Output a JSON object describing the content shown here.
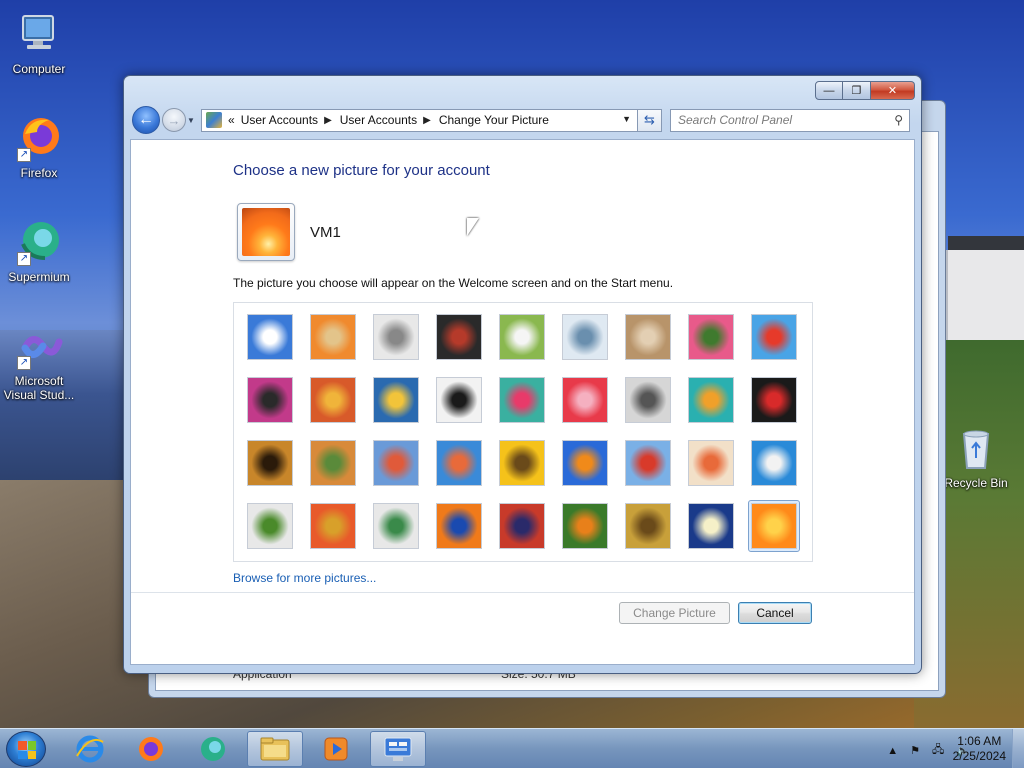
{
  "desktop": {
    "icons": [
      {
        "label": "Computer"
      },
      {
        "label": "Firefox"
      },
      {
        "label": "Supermium"
      },
      {
        "label": "Microsoft Visual Stud..."
      },
      {
        "label": "Recycle Bin"
      }
    ]
  },
  "background_window": {
    "bottom_left_text": "Application",
    "bottom_mid_text": "Size: 50.7 MB"
  },
  "window": {
    "controls": {
      "minimize": "—",
      "maximize": "❐",
      "close": "✕"
    },
    "breadcrumb": [
      "User Accounts",
      "User Accounts",
      "Change Your Picture"
    ],
    "breadcrumb_prefix": "«",
    "search": {
      "placeholder": "Search Control Panel"
    },
    "heading": "Choose a new picture for your account",
    "username": "VM1",
    "description": "The picture you choose will appear on the Welcome screen and on the Start menu.",
    "pictures": [
      {
        "name": "roller-coaster",
        "colors": [
          "#3a7ad8",
          "#ffffff"
        ]
      },
      {
        "name": "starfish",
        "colors": [
          "#f08a2e",
          "#e3c48a"
        ]
      },
      {
        "name": "robot-toy",
        "colors": [
          "#e8e8e8",
          "#888888"
        ]
      },
      {
        "name": "record-player",
        "colors": [
          "#2a2a2a",
          "#b53a2a"
        ]
      },
      {
        "name": "lucky-cat",
        "colors": [
          "#8ab84f",
          "#f5f5f5"
        ]
      },
      {
        "name": "spinning-top",
        "colors": [
          "#dfe9f2",
          "#6a8fae"
        ]
      },
      {
        "name": "kitten",
        "colors": [
          "#b8946a",
          "#e3cfb3"
        ]
      },
      {
        "name": "pink-flower",
        "colors": [
          "#e85a8a",
          "#3f7a2e"
        ]
      },
      {
        "name": "ferris-wheel",
        "colors": [
          "#49a4e6",
          "#e63a2a"
        ]
      },
      {
        "name": "ball",
        "colors": [
          "#c23a8a",
          "#2a2a2a"
        ]
      },
      {
        "name": "fabric",
        "colors": [
          "#d85a2a",
          "#f0b43a"
        ]
      },
      {
        "name": "leaf",
        "colors": [
          "#2a6ab0",
          "#f2c43a"
        ]
      },
      {
        "name": "dog",
        "colors": [
          "#f2f2f2",
          "#1a1a1a"
        ]
      },
      {
        "name": "crayons",
        "colors": [
          "#3ab0a0",
          "#e83a6a"
        ]
      },
      {
        "name": "paper-star",
        "colors": [
          "#e83a4a",
          "#f5b0c0"
        ]
      },
      {
        "name": "jacks",
        "colors": [
          "#d6d6d6",
          "#555555"
        ]
      },
      {
        "name": "stairs",
        "colors": [
          "#2ab0b0",
          "#f0a02a"
        ]
      },
      {
        "name": "paper-crane",
        "colors": [
          "#1a1a1a",
          "#d82a2a"
        ]
      },
      {
        "name": "guitar",
        "colors": [
          "#c8862a",
          "#2a1a0a"
        ]
      },
      {
        "name": "puppy",
        "colors": [
          "#d88a3a",
          "#5a8a3a"
        ]
      },
      {
        "name": "toy-robot",
        "colors": [
          "#6a9ad8",
          "#e05a3a"
        ]
      },
      {
        "name": "textile",
        "colors": [
          "#3a8ad8",
          "#e86a3a"
        ]
      },
      {
        "name": "sunflower",
        "colors": [
          "#f5c21a",
          "#6a4a1a"
        ]
      },
      {
        "name": "fish",
        "colors": [
          "#2a6ad8",
          "#f08a1a"
        ]
      },
      {
        "name": "hot-air-balloon",
        "colors": [
          "#7ab0e6",
          "#d83a2a"
        ]
      },
      {
        "name": "doll",
        "colors": [
          "#f2e0c8",
          "#e86a3a"
        ]
      },
      {
        "name": "sailboat",
        "colors": [
          "#2a8ad8",
          "#f2f2f2"
        ]
      },
      {
        "name": "soccer-ball",
        "colors": [
          "#e8e8e8",
          "#4a8a2a"
        ]
      },
      {
        "name": "fabric-stripes",
        "colors": [
          "#e85a2a",
          "#d8a02a"
        ]
      },
      {
        "name": "marbles",
        "colors": [
          "#e8e8e8",
          "#3a8a4a"
        ]
      },
      {
        "name": "window-frame",
        "colors": [
          "#f07a1a",
          "#1a4ab0"
        ]
      },
      {
        "name": "rug",
        "colors": [
          "#c83a2a",
          "#2a2a6a"
        ]
      },
      {
        "name": "butterfly",
        "colors": [
          "#3a7a2a",
          "#e8801a"
        ]
      },
      {
        "name": "basket",
        "colors": [
          "#c8a03a",
          "#6a4a1a"
        ]
      },
      {
        "name": "lighthouse",
        "colors": [
          "#1a3a8a",
          "#f5f0c8"
        ]
      },
      {
        "name": "orange-flower",
        "colors": [
          "#ff8a1a",
          "#ffd24a"
        ],
        "selected": true
      }
    ],
    "browse_link": "Browse for more pictures...",
    "buttons": {
      "change": "Change Picture",
      "cancel": "Cancel"
    }
  },
  "taskbar": {
    "items": [
      {
        "name": "internet-explorer",
        "active": false
      },
      {
        "name": "firefox",
        "active": false
      },
      {
        "name": "supermium",
        "active": false
      },
      {
        "name": "file-explorer",
        "active": true
      },
      {
        "name": "media-player",
        "active": false
      },
      {
        "name": "control-panel",
        "active": true
      }
    ],
    "clock": {
      "time": "1:06 AM",
      "date": "2/25/2024"
    }
  }
}
